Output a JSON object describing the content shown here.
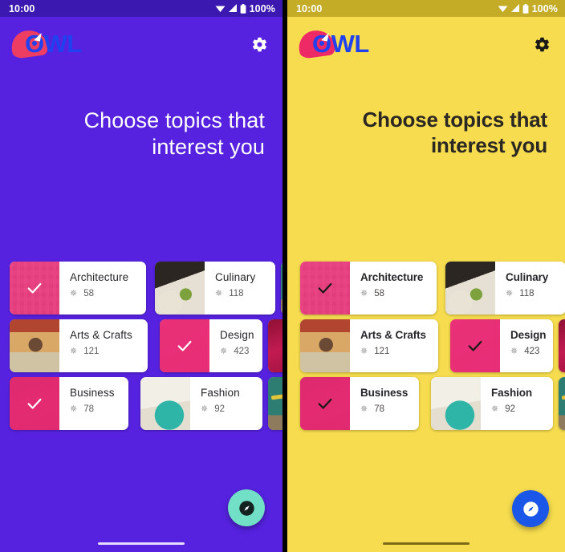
{
  "status_bar": {
    "time": "10:00",
    "battery_pct": "100%",
    "icons": [
      "wifi-icon",
      "signal-icon",
      "battery-icon"
    ]
  },
  "panels": [
    {
      "id": "left",
      "theme_name": "purple-theme",
      "bg_color": "#5622e0",
      "status_bar_color": "#3b19b0",
      "accent_color": "#e82e76",
      "heading": "Choose topics that interest you",
      "heading_color": "#ffffff",
      "logo_text": "OWL",
      "settings_icon": "gear-icon",
      "fab": {
        "icon": "explore-compass-icon",
        "bg": "#72e0c6",
        "icon_color": "#13231f"
      },
      "check_color": "#ffffff"
    },
    {
      "id": "right",
      "theme_name": "yellow-theme",
      "bg_color": "#f6dc4e",
      "status_bar_color": "#c4ac27",
      "accent_color": "#e82e76",
      "heading": "Choose topics that interest you",
      "heading_color": "#2b2823",
      "logo_text": "OWL",
      "settings_icon": "gear-icon",
      "fab": {
        "icon": "explore-compass-icon",
        "bg": "#1a56e8",
        "icon_color": "#ffffff"
      },
      "check_color": "#1b1a17"
    }
  ],
  "topics": {
    "count_icon": "grain-icon",
    "rows": [
      [
        {
          "name": "Architecture",
          "count": "58",
          "selected": true,
          "thumb": "architecture-thumb"
        },
        {
          "name": "Culinary",
          "count": "118",
          "selected": false,
          "thumb": "culinary-thumb"
        }
      ],
      [
        {
          "name": "Arts & Crafts",
          "count": "121",
          "selected": false,
          "thumb": "arts-crafts-thumb"
        },
        {
          "name": "Design",
          "count": "423",
          "selected": true,
          "thumb": "design-thumb"
        }
      ],
      [
        {
          "name": "Business",
          "count": "78",
          "selected": true,
          "thumb": "business-thumb"
        },
        {
          "name": "Fashion",
          "count": "92",
          "selected": false,
          "thumb": "fashion-thumb"
        }
      ]
    ]
  }
}
